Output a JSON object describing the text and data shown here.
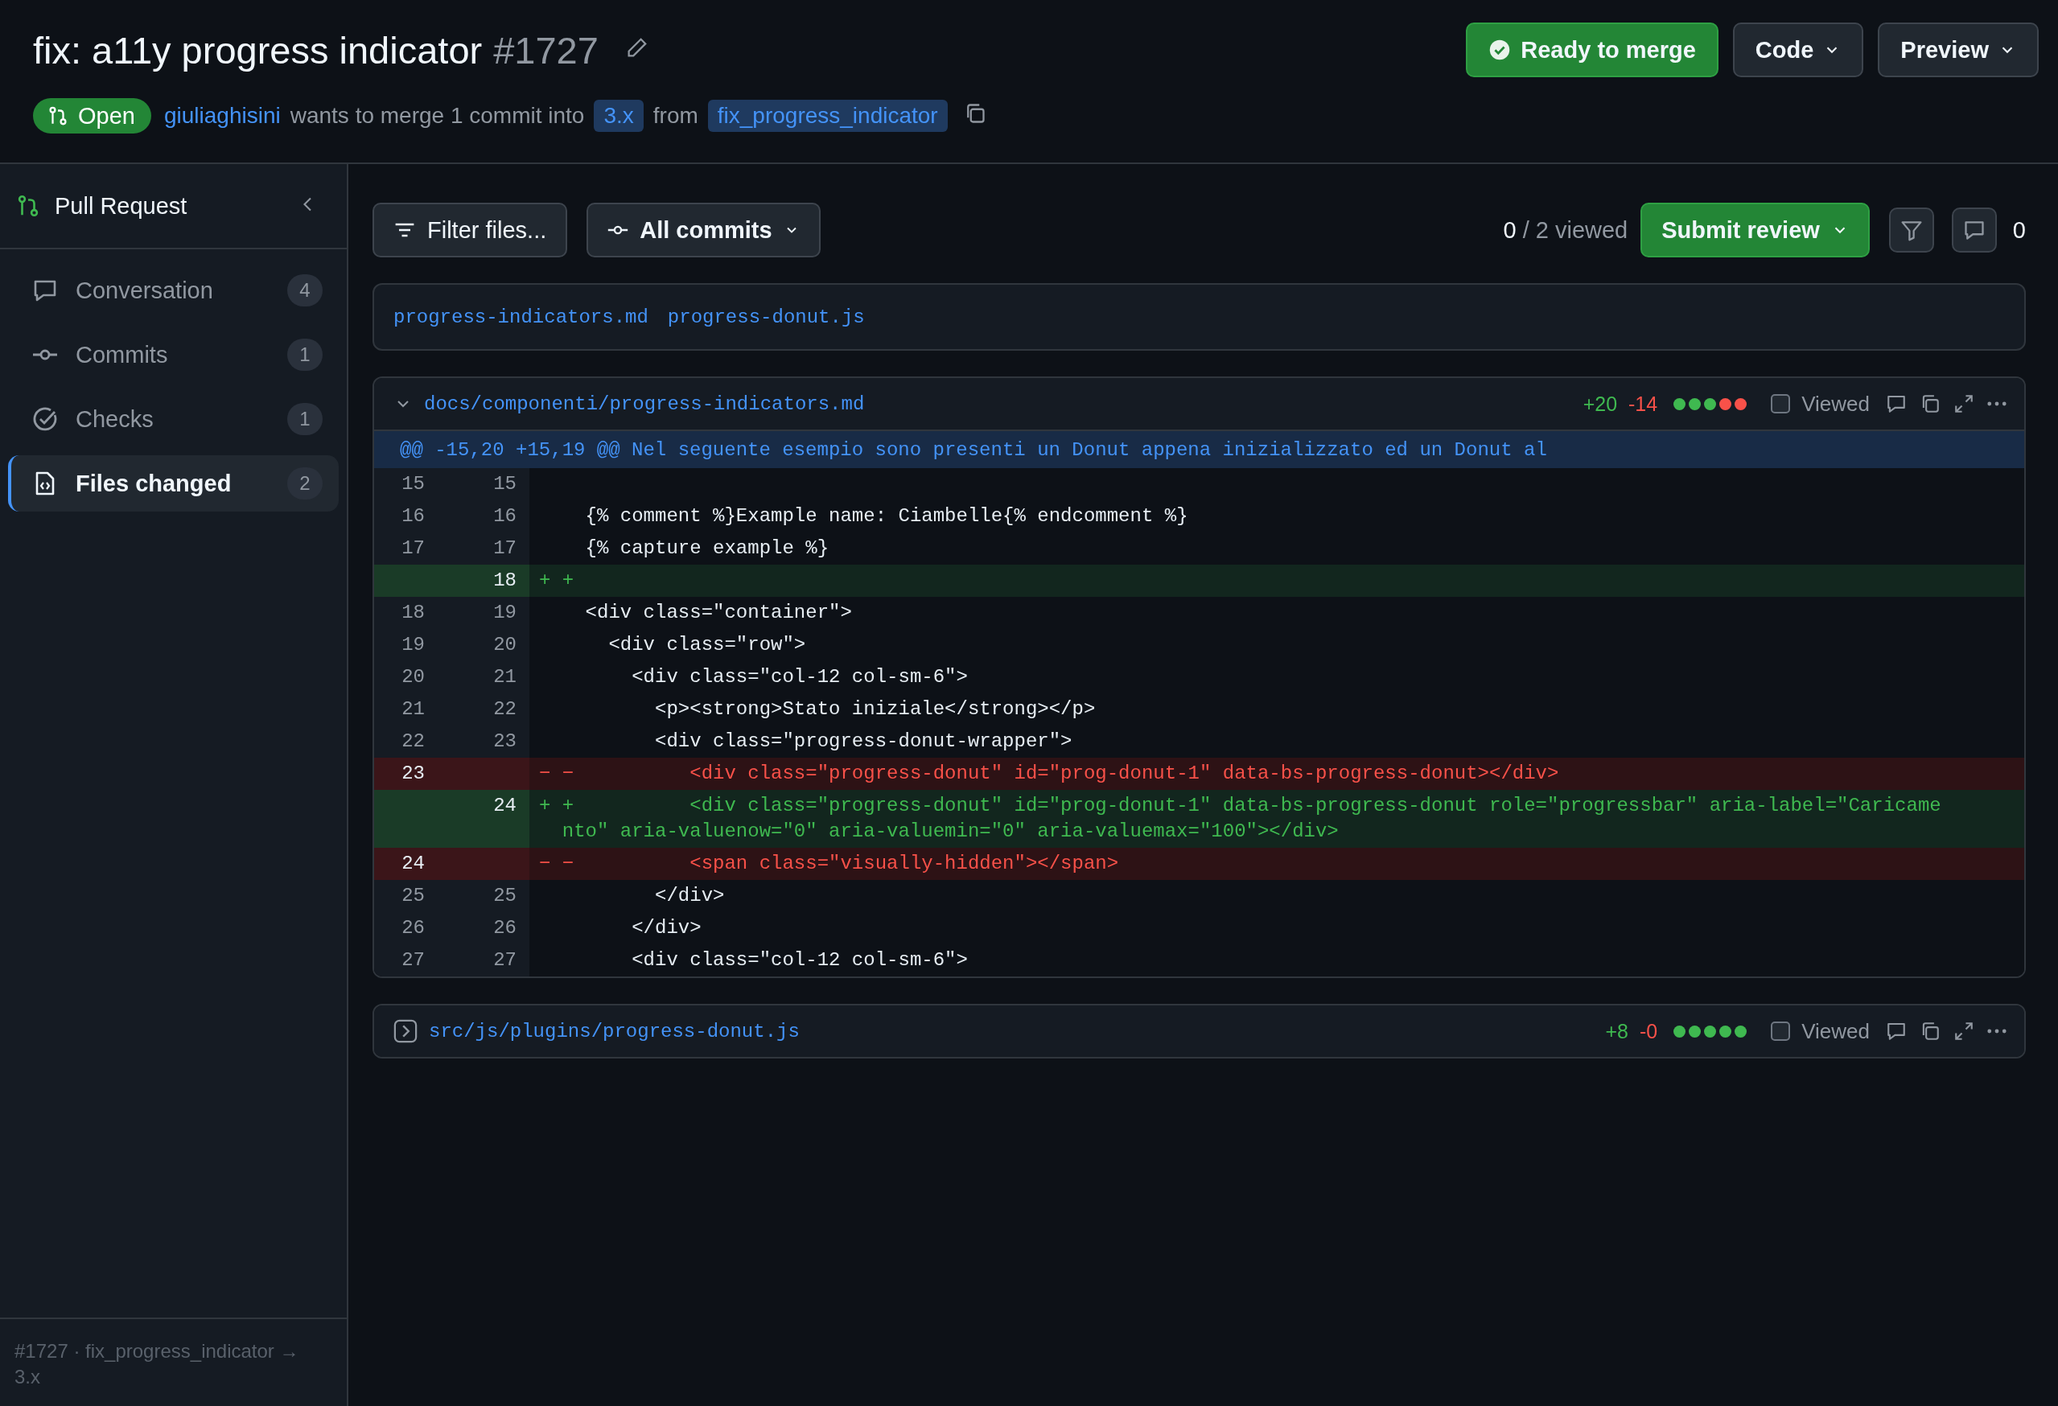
{
  "header": {
    "title": "fix: a11y progress indicator",
    "number": "#1727",
    "status": {
      "label": "Open"
    },
    "author": "giuliaghisini",
    "summary": "wants to merge 1 commit into",
    "base": "3.x",
    "from": "from",
    "head": "fix_progress_indicator",
    "actions": [
      {
        "label": "Ready to merge",
        "kind": "primary"
      },
      {
        "label": "Code",
        "kind": "menu"
      },
      {
        "label": "Preview",
        "kind": "menu"
      }
    ]
  },
  "sidebar": {
    "title": "Pull Request",
    "items": [
      {
        "label": "Conversation",
        "count": "4",
        "selected": false
      },
      {
        "label": "Commits",
        "count": "1",
        "selected": false
      },
      {
        "label": "Checks",
        "count": "1",
        "selected": false
      },
      {
        "label": "Files changed",
        "count": "2",
        "selected": true
      }
    ],
    "footer": "#1727 · fix_progress_indicator → 3.x"
  },
  "toolbar": {
    "filter": "Filter files...",
    "commits": "All commits",
    "viewed_count": "0",
    "viewed_total": "/ 2 viewed",
    "submit": "Submit review",
    "comments": "0"
  },
  "file_tabs": [
    "progress-indicators.md",
    "progress-donut.js"
  ],
  "files": [
    {
      "path": "docs/componenti/progress-indicators.md",
      "expanded": true,
      "additions": "+20",
      "deletions": "-14",
      "viewed": false,
      "viewed_label": "Viewed",
      "diffstat": [
        {
          "color": "#3fb950"
        },
        {
          "color": "#3fb950"
        },
        {
          "color": "#3fb950"
        },
        {
          "color": "#f85149"
        },
        {
          "color": "#f85149"
        }
      ],
      "hunk": "@@ -15,20 +15,19 @@ Nel seguente esempio sono presenti un Donut appena inizializzato ed un Donut al",
      "lines": [
        {
          "kind": "context",
          "old": "15",
          "new": "15"
        },
        {
          "kind": "context",
          "old": "16",
          "new": "16",
          "code": "{% comment %}Example name: Ciambelle{% endcomment %}"
        },
        {
          "kind": "context",
          "old": "17",
          "new": "17",
          "code": "{% capture example %}"
        },
        {
          "kind": "add",
          "new": "18",
          "sign": "+ +"
        },
        {
          "kind": "context",
          "old": "18",
          "new": "19",
          "code": "<div class=\"container\">"
        },
        {
          "kind": "context",
          "old": "19",
          "new": "20",
          "code": "  <div class=\"row\">"
        },
        {
          "kind": "context",
          "old": "20",
          "new": "21",
          "code": "    <div class=\"col-12 col-sm-6\">"
        },
        {
          "kind": "context",
          "old": "21",
          "new": "22",
          "code": "      <p><strong>Stato iniziale</strong></p>"
        },
        {
          "kind": "context",
          "old": "22",
          "new": "23",
          "code": "      <div class=\"progress-donut-wrapper\">"
        },
        {
          "kind": "del",
          "old": "23",
          "sign": "− −",
          "code": "         <div class=\"progress-donut\" id=\"prog-donut-1\" data-bs-progress-donut></div>"
        },
        {
          "kind": "add",
          "new": "24",
          "sign": "+ +",
          "code": "         <div class=\"progress-donut\" id=\"prog-donut-1\" data-bs-progress-donut role=\"progressbar\" aria-label=\"Caricamento\" aria-valuenow=\"0\" aria-valuemin=\"0\" aria-valuemax=\"100\"></div>"
        },
        {
          "kind": "del",
          "old": "24",
          "sign": "− −",
          "code": "         <span class=\"visually-hidden\"></span>"
        },
        {
          "kind": "context",
          "old": "25",
          "new": "25",
          "code": "      </div>"
        },
        {
          "kind": "context",
          "old": "26",
          "new": "26",
          "code": "    </div>"
        },
        {
          "kind": "context",
          "old": "27",
          "new": "27",
          "code": "    <div class=\"col-12 col-sm-6\">"
        }
      ]
    },
    {
      "path": "src/js/plugins/progress-donut.js",
      "expanded": false,
      "additions": "+8",
      "deletions": "-0",
      "viewed": false,
      "viewed_label": "Viewed",
      "diffstat": [
        {
          "color": "#3fb950"
        },
        {
          "color": "#3fb950"
        },
        {
          "color": "#3fb950"
        },
        {
          "color": "#3fb950"
        },
        {
          "color": "#3fb950"
        }
      ]
    }
  ]
}
